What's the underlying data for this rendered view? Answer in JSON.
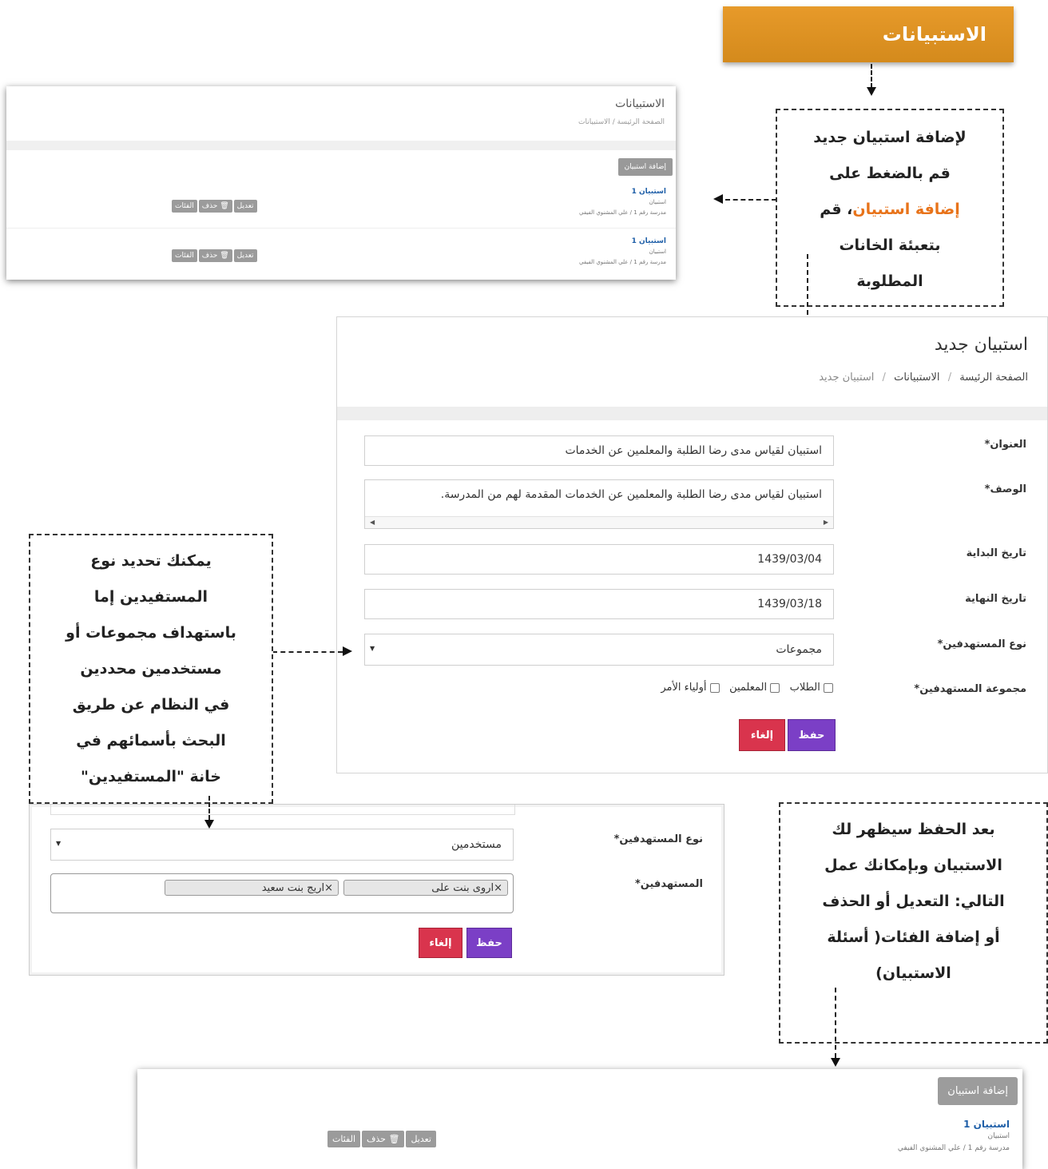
{
  "banner": {
    "title": "الاستبيانات"
  },
  "notes": {
    "add_survey": {
      "line1": "لإضافة استبيان جديد",
      "line2": "قم بالضغط على",
      "line3_highlight": "إضافة استبيان",
      "line3_rest": "، قم",
      "line4": "بتعبئة الخانات",
      "line5": "المطلوبة"
    },
    "target_type": {
      "line1": "يمكنك تحديد نوع",
      "line2": "المستفيدين إما",
      "line3": "باستهداف مجموعات أو",
      "line4": "مستخدمين محددين",
      "line5": "في النظام عن طريق",
      "line6": "البحث بأسمائهم في",
      "line7": "خانة \"المستفيدين\""
    },
    "after_save": {
      "line1": "بعد الحفظ سيظهر لك",
      "line2": "الاستبيان وبإمكانك عمل",
      "line3": "التالي: التعديل أو الحذف",
      "line4": "أو إضافة الفئات( أسئلة",
      "line5": "الاستبيان)"
    }
  },
  "list_screen": {
    "page_title": "الاستبيانات",
    "breadcrumb": {
      "home": "الصفحة الرئيسة",
      "sep": "/",
      "current": "الاستبيانات"
    },
    "add_button": "إضافة استبيان",
    "items": [
      {
        "title": "استبيان 1",
        "type": "استبيان",
        "meta": "مدرسة رقم 1 / علي المشنوي الفيفي",
        "edit": "تعديل",
        "delete": "حذف",
        "categories": "الفئات"
      },
      {
        "title": "استبيان 1",
        "type": "استبيان",
        "meta": "مدرسة رقم 1 / علي المشنوي الفيفي",
        "edit": "تعديل",
        "delete": "حذف",
        "categories": "الفئات"
      }
    ]
  },
  "form_screen": {
    "page_title": "استبيان جديد",
    "breadcrumb": {
      "home": "الصفحة الرئيسة",
      "sep1": "/",
      "surveys": "الاستبيانات",
      "sep2": "/",
      "current": "استبيان جديد"
    },
    "fields": {
      "title_label": "العنوان*",
      "title_value": "استبيان لقياس مدى رضا الطلبة والمعلمين عن الخدمات",
      "desc_label": "الوصف*",
      "desc_value": "استبيان لقياس مدى رضا الطلبة والمعلمين عن الخدمات المقدمة لهم من المدرسة.",
      "start_label": "تاريخ البداية",
      "start_value": "1439/03/04",
      "end_label": "تاريخ النهاية",
      "end_value": "1439/03/18",
      "target_type_label": "نوع المستهدفين*",
      "target_type_value": "مجموعات",
      "target_group_label": "مجموعة المستهدفين*",
      "groups": [
        "الطلاب",
        "المعلمين",
        "أولياء الأمر"
      ]
    },
    "save": "حفظ",
    "cancel": "إلغاء"
  },
  "users_screen": {
    "target_type_label": "نوع المستهدفين*",
    "target_type_value": "مستخدمين",
    "targets_label": "المستهدفين*",
    "tags": [
      {
        "remove": "×",
        "name": "اروى بنت على"
      },
      {
        "remove": "×",
        "name": "اريج بنت سعيد"
      }
    ],
    "save": "حفظ",
    "cancel": "إلغاء"
  },
  "result_screen": {
    "add_button": "إضافة استبيان",
    "item": {
      "title": "استبيان 1",
      "type": "استبيان",
      "meta": "مدرسة رقم 1 / علي المشنوي الفيفي",
      "edit": "تعديل",
      "delete": "حذف",
      "categories": "الفئات"
    }
  }
}
